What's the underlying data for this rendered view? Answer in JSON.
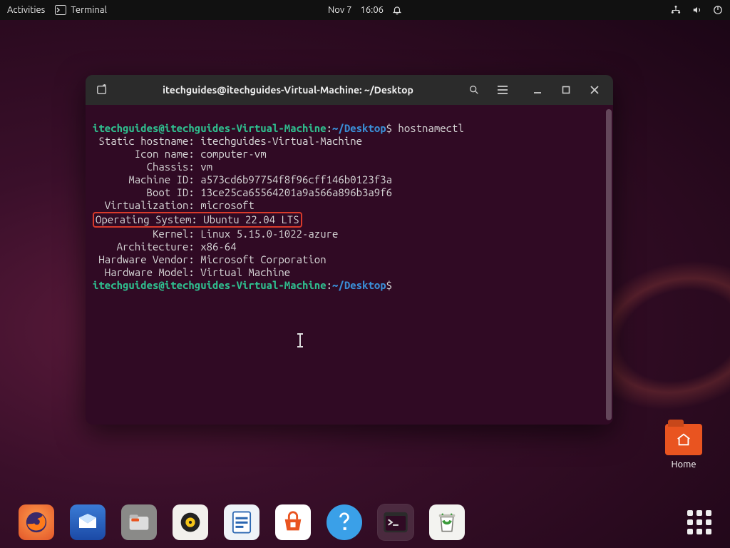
{
  "topbar": {
    "activities": "Activities",
    "app_label": "Terminal",
    "date": "Nov 7",
    "time": "16:06"
  },
  "desktop": {
    "home_label": "Home"
  },
  "terminal": {
    "title": "itechguides@itechguides-Virtual-Machine: ~/Desktop",
    "prompt_user": "itechguides@itechguides-Virtual-Machine",
    "prompt_colon": ":",
    "prompt_tilde": "~",
    "prompt_path": "/Desktop",
    "prompt_dollar": "$",
    "command1": " hostnamectl",
    "lines": {
      "static_hostname": " Static hostname: itechguides-Virtual-Machine",
      "icon_name": "       Icon name: computer-vm",
      "chassis": "         Chassis: vm",
      "machine_id": "      Machine ID: a573cd6b97754f8f96cff146b0123f3a",
      "boot_id": "         Boot ID: 13ce25ca65564201a9a566a896b3a9f6",
      "virtualization": "  Virtualization: microsoft",
      "operating_system": "Operating System: Ubuntu 22.04 LTS",
      "kernel": "          Kernel: Linux 5.15.0-1022-azure",
      "architecture": "    Architecture: x86-64",
      "hardware_vendor": " Hardware Vendor: Microsoft Corporation",
      "hardware_model": "  Hardware Model: Virtual Machine"
    }
  },
  "dock": {
    "items": [
      "firefox",
      "thunderbird",
      "files",
      "rhythmbox",
      "libreoffice",
      "software",
      "help",
      "terminal",
      "trash"
    ]
  }
}
